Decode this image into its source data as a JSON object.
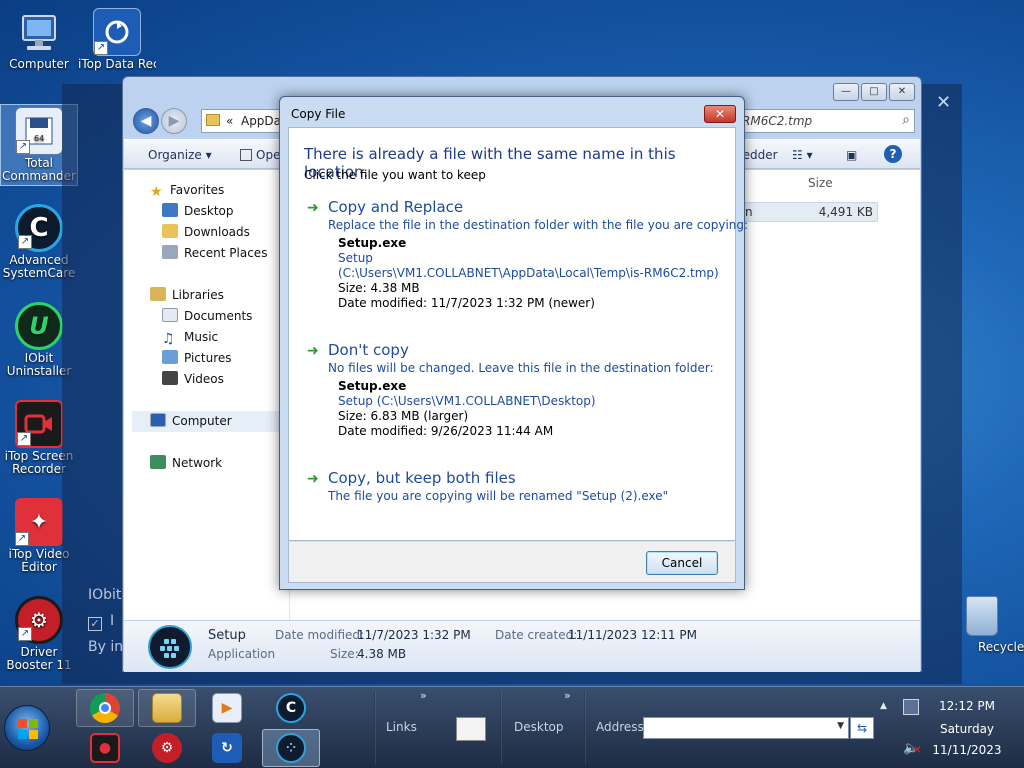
{
  "desktop": {
    "icons": [
      {
        "label": "Computer",
        "icon": "computer-icon"
      },
      {
        "label": "iTop Data Recov...",
        "icon": "itop-data-recovery-icon"
      },
      {
        "label": "Total Commander",
        "icon": "total-commander-icon"
      },
      {
        "label": "Advanced SystemCare",
        "icon": "advanced-systemcare-icon"
      },
      {
        "label": "IObit Uninstaller",
        "icon": "iobit-uninstaller-icon"
      },
      {
        "label": "iTop Screen Recorder",
        "icon": "itop-screen-recorder-icon"
      },
      {
        "label": "iTop Video Editor",
        "icon": "itop-video-editor-icon"
      },
      {
        "label": "Driver Booster 11",
        "icon": "driver-booster-icon"
      },
      {
        "label": "Recycle Bin",
        "icon": "recycle-bin-icon"
      }
    ],
    "background_text": {
      "line1": "IObit",
      "line2": "I",
      "line3": "By in"
    }
  },
  "explorer": {
    "caption": {
      "minimize": "—",
      "maximize": "□",
      "close": "✕"
    },
    "address": {
      "prefix": "«",
      "crumb": "AppData",
      "tail": "RM6C2.tmp"
    },
    "toolbar": {
      "organize": "Organize ▾",
      "open": "Ope",
      "shredder": "redder"
    },
    "nav_pane": {
      "favorites": "Favorites",
      "desktop": "Desktop",
      "downloads": "Downloads",
      "recent_places": "Recent Places",
      "libraries": "Libraries",
      "documents": "Documents",
      "music": "Music",
      "pictures": "Pictures",
      "videos": "Videos",
      "computer": "Computer",
      "network": "Network"
    },
    "file_list": {
      "size_header": "Size",
      "row_fragment": "n",
      "row_size": "4,491 KB"
    },
    "details": {
      "name": "Setup",
      "type": "Application",
      "date_modified_label": "Date modified:",
      "date_modified": "11/7/2023 1:32 PM",
      "date_created_label": "Date created:",
      "date_created": "11/11/2023 12:11 PM",
      "size_label": "Size:",
      "size": "4.38 MB"
    }
  },
  "dialog": {
    "title": "Copy File",
    "close": "✕",
    "heading": "There is already a file with the same name in this location.",
    "subheading": "Click the file you want to keep",
    "options": {
      "replace": {
        "title": "Copy and Replace",
        "desc": "Replace the file in the destination folder with the file you are copying:",
        "file_name": "Setup.exe",
        "path_line1": "Setup",
        "path_line2": "(C:\\Users\\VM1.COLLABNET\\AppData\\Local\\Temp\\is-RM6C2.tmp)",
        "size": "Size: 4.38 MB",
        "modified": "Date modified: 11/7/2023 1:32 PM (newer)"
      },
      "dont_copy": {
        "title": "Don't copy",
        "desc": "No files will be changed. Leave this file in the destination folder:",
        "file_name": "Setup.exe",
        "path": "Setup (C:\\Users\\VM1.COLLABNET\\Desktop)",
        "size": "Size: 6.83 MB (larger)",
        "modified": "Date modified: 9/26/2023 11:44 AM"
      },
      "keep_both": {
        "title": "Copy, but keep both files",
        "desc": "The file you are copying will be renamed \"Setup (2).exe\""
      }
    },
    "cancel": "Cancel"
  },
  "taskbar": {
    "links_label": "Links",
    "desktop_label": "Desktop",
    "address_label": "Address",
    "address_value": "",
    "chevron": "»",
    "time": "12:12 PM",
    "day": "Saturday",
    "date": "11/11/2023"
  }
}
